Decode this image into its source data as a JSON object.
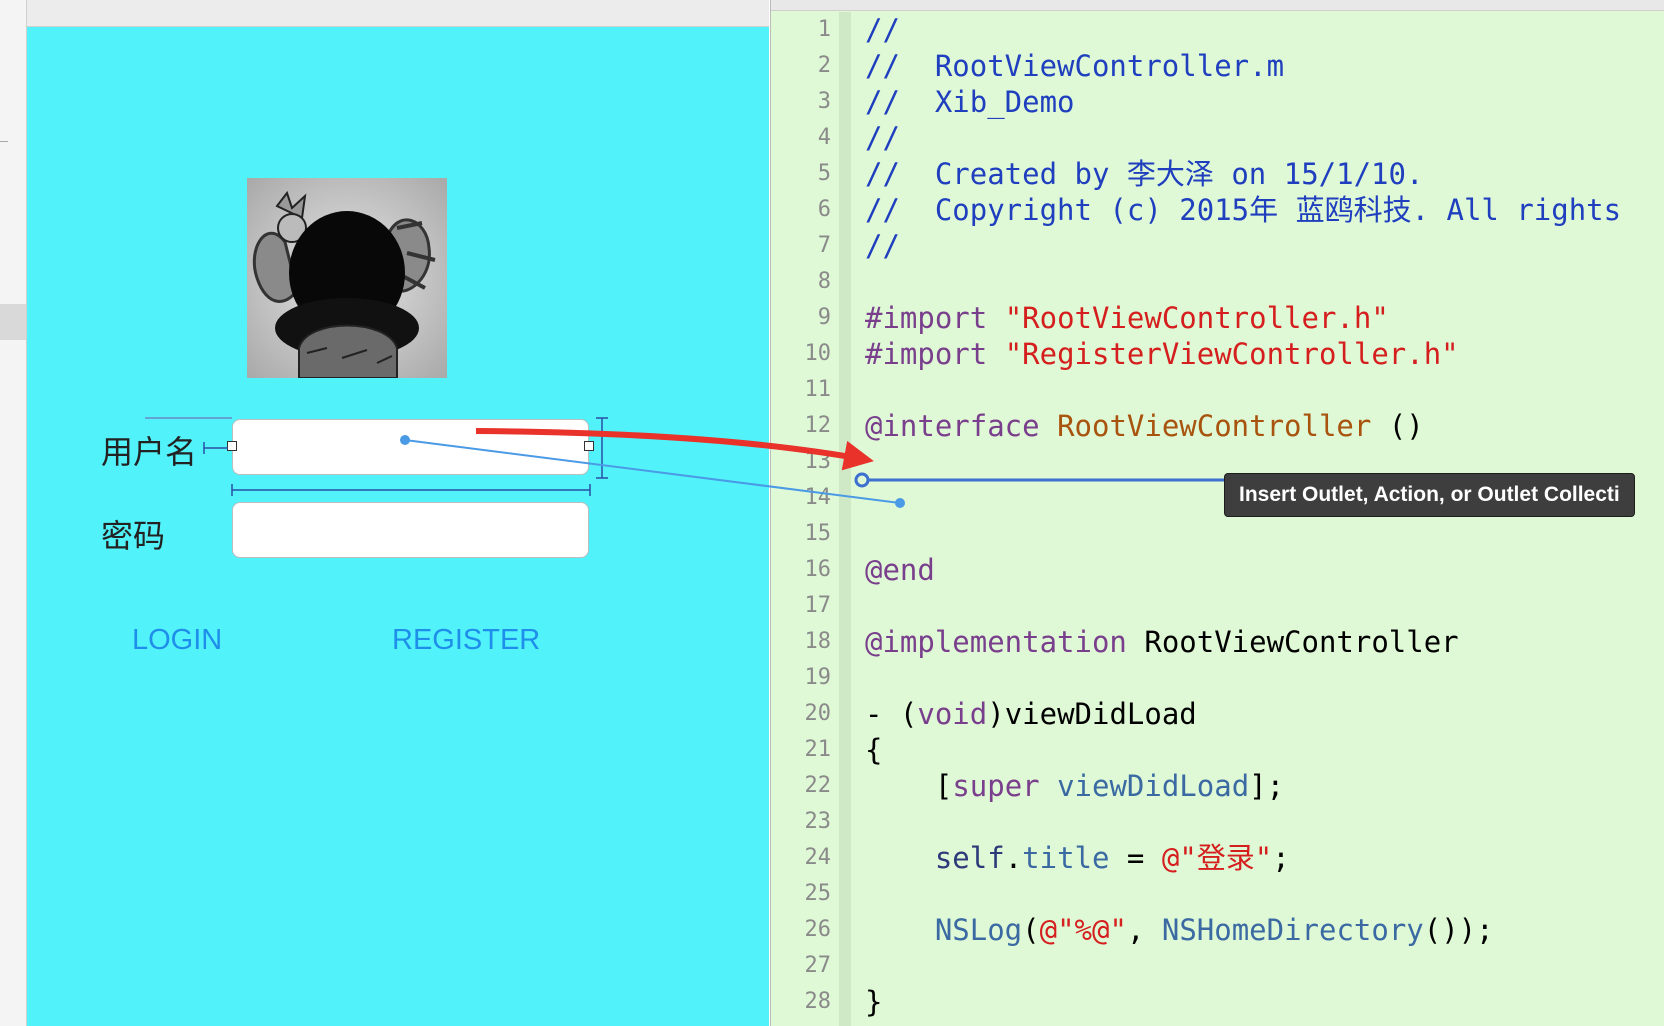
{
  "interface_builder": {
    "username_label": "用户名",
    "password_label": "密码",
    "username_field_value": "",
    "password_field_value": "",
    "login_label": "LOGIN",
    "register_label": "REGISTER",
    "canvas_color": "#52f2fa"
  },
  "editor": {
    "lines": [
      {
        "n": "1",
        "parts": [
          {
            "c": "com",
            "t": "//"
          }
        ]
      },
      {
        "n": "2",
        "parts": [
          {
            "c": "com",
            "t": "//  RootViewController.m"
          }
        ]
      },
      {
        "n": "3",
        "parts": [
          {
            "c": "com",
            "t": "//  Xib_Demo"
          }
        ]
      },
      {
        "n": "4",
        "parts": [
          {
            "c": "com",
            "t": "//"
          }
        ]
      },
      {
        "n": "5",
        "parts": [
          {
            "c": "com",
            "t": "//  Created by 李大泽 on 15/1/10."
          }
        ]
      },
      {
        "n": "6",
        "parts": [
          {
            "c": "com",
            "t": "//  Copyright (c) 2015年 蓝鸥科技. All rights"
          }
        ]
      },
      {
        "n": "7",
        "parts": [
          {
            "c": "com",
            "t": "//"
          }
        ]
      },
      {
        "n": "8",
        "parts": []
      },
      {
        "n": "9",
        "parts": [
          {
            "c": "key",
            "t": "#import "
          },
          {
            "c": "str",
            "t": "\"RootViewController.h\""
          }
        ]
      },
      {
        "n": "10",
        "parts": [
          {
            "c": "key",
            "t": "#import "
          },
          {
            "c": "str",
            "t": "\"RegisterViewController.h\""
          }
        ]
      },
      {
        "n": "11",
        "parts": []
      },
      {
        "n": "12",
        "parts": [
          {
            "c": "key",
            "t": "@interface "
          },
          {
            "c": "cls",
            "t": "RootViewController"
          },
          {
            "c": "plain",
            "t": " ()"
          }
        ]
      },
      {
        "n": "13",
        "parts": []
      },
      {
        "n": "14",
        "parts": []
      },
      {
        "n": "15",
        "parts": []
      },
      {
        "n": "16",
        "parts": [
          {
            "c": "key",
            "t": "@end"
          }
        ]
      },
      {
        "n": "17",
        "parts": []
      },
      {
        "n": "18",
        "parts": [
          {
            "c": "key",
            "t": "@implementation "
          },
          {
            "c": "plain",
            "t": "RootViewController"
          }
        ]
      },
      {
        "n": "19",
        "parts": []
      },
      {
        "n": "20",
        "parts": [
          {
            "c": "plain",
            "t": "- ("
          },
          {
            "c": "key",
            "t": "void"
          },
          {
            "c": "plain",
            "t": ")viewDidLoad"
          }
        ]
      },
      {
        "n": "21",
        "parts": [
          {
            "c": "plain",
            "t": "{"
          }
        ]
      },
      {
        "n": "22",
        "parts": [
          {
            "c": "plain",
            "t": "    ["
          },
          {
            "c": "key",
            "t": "super"
          },
          {
            "c": "plain",
            "t": " "
          },
          {
            "c": "api",
            "t": "viewDidLoad"
          },
          {
            "c": "plain",
            "t": "];"
          }
        ]
      },
      {
        "n": "23",
        "parts": []
      },
      {
        "n": "24",
        "parts": [
          {
            "c": "plain",
            "t": "    "
          },
          {
            "c": "at",
            "t": "self"
          },
          {
            "c": "plain",
            "t": "."
          },
          {
            "c": "api",
            "t": "title"
          },
          {
            "c": "plain",
            "t": " = "
          },
          {
            "c": "str",
            "t": "@\"登录\""
          },
          {
            "c": "plain",
            "t": ";"
          }
        ]
      },
      {
        "n": "25",
        "parts": []
      },
      {
        "n": "26",
        "parts": [
          {
            "c": "plain",
            "t": "    "
          },
          {
            "c": "api",
            "t": "NSLog"
          },
          {
            "c": "plain",
            "t": "("
          },
          {
            "c": "str",
            "t": "@\"%@\""
          },
          {
            "c": "plain",
            "t": ", "
          },
          {
            "c": "api",
            "t": "NSHomeDirectory"
          },
          {
            "c": "plain",
            "t": "());"
          }
        ]
      },
      {
        "n": "27",
        "parts": []
      },
      {
        "n": "28",
        "parts": [
          {
            "c": "plain",
            "t": "}"
          }
        ]
      }
    ]
  },
  "connection_tooltip": "Insert Outlet, Action, or Outlet Collecti",
  "colors": {
    "editor_bg": "#dff9d6",
    "drag_line": "#4a7bd8",
    "red_arrow": "#e8322a"
  }
}
